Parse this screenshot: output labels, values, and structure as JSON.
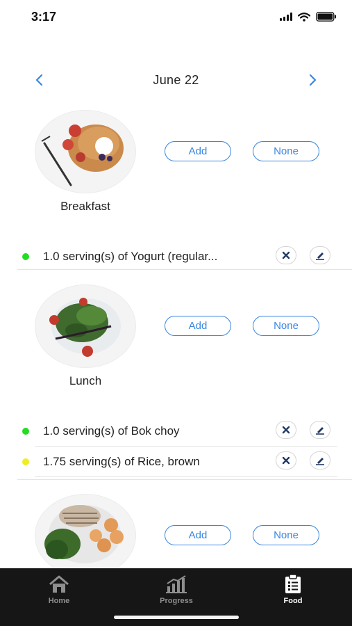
{
  "status_bar": {
    "time": "3:17"
  },
  "date_nav": {
    "date": "June 22",
    "prev_icon": "chevron-left-icon",
    "next_icon": "chevron-right-icon"
  },
  "colors": {
    "accent": "#3a86e0",
    "green_dot": "#22dd22",
    "yellow_dot": "#eeee22",
    "tab_bar": "#161616"
  },
  "meals": [
    {
      "name": "Breakfast",
      "add_label": "Add",
      "none_label": "None",
      "entries": [
        {
          "text": "1.0 serving(s) of Yogurt (regular...",
          "status": "green"
        }
      ]
    },
    {
      "name": "Lunch",
      "add_label": "Add",
      "none_label": "None",
      "entries": [
        {
          "text": "1.0 serving(s) of Bok choy",
          "status": "green"
        },
        {
          "text": "1.75 serving(s) of Rice, brown",
          "status": "yellow"
        }
      ]
    },
    {
      "name": "",
      "add_label": "Add",
      "none_label": "None",
      "entries": []
    }
  ],
  "tab_bar": {
    "active": "Food",
    "tabs": [
      {
        "label": "Home",
        "icon": "home-icon"
      },
      {
        "label": "Progress",
        "icon": "progress-chart-icon"
      },
      {
        "label": "Food",
        "icon": "clipboard-list-icon"
      }
    ]
  }
}
